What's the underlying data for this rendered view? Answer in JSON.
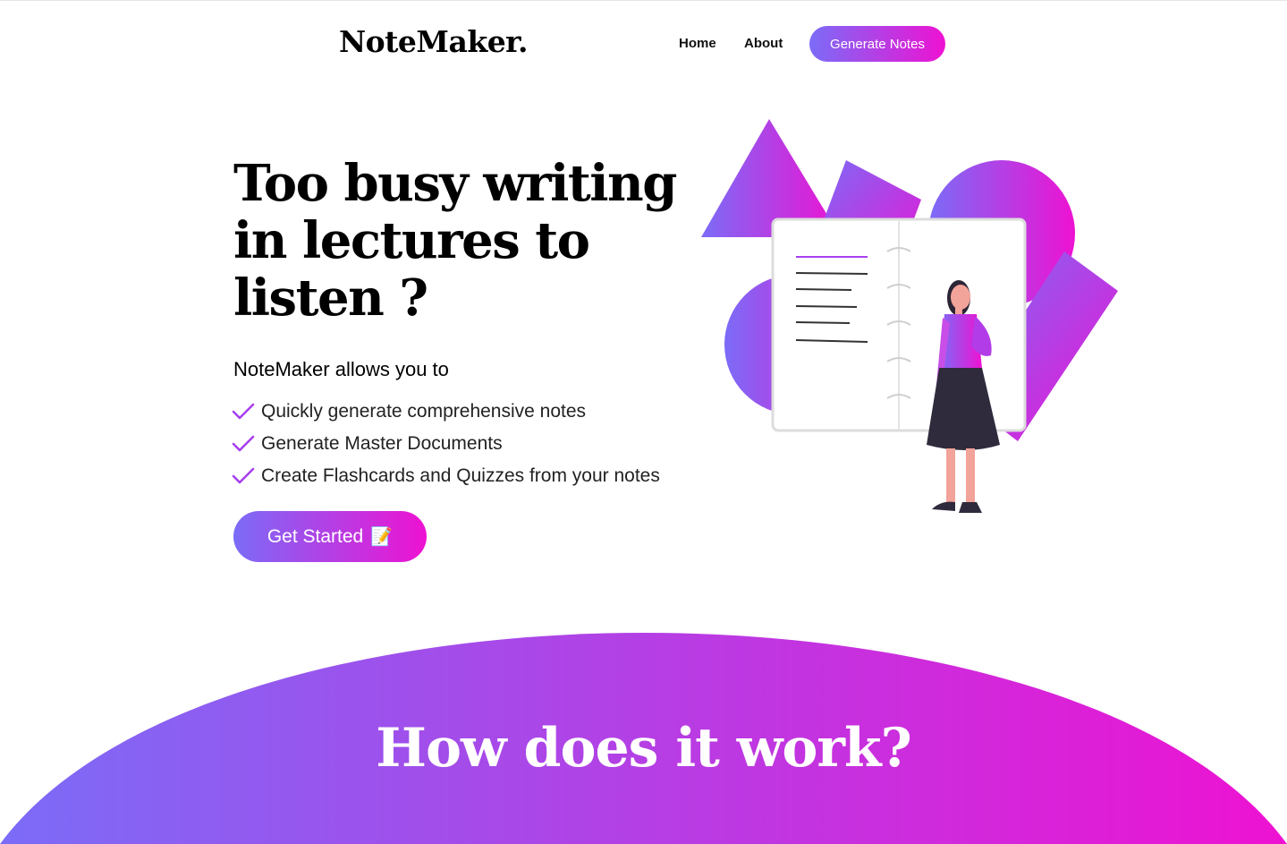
{
  "nav": {
    "logo": "NoteMaker.",
    "links": [
      {
        "label": "Home"
      },
      {
        "label": "About"
      }
    ],
    "cta_label": "Generate Notes"
  },
  "hero": {
    "title": "Too busy writing in lectures to listen ?",
    "subtitle": "NoteMaker allows you to",
    "features": [
      "Quickly generate comprehensive notes",
      "Generate Master Documents",
      "Create Flashcards and Quizzes from your notes"
    ],
    "cta_label": "Get Started",
    "cta_emoji": "📝"
  },
  "section": {
    "title": "How does it work?"
  },
  "colors": {
    "gradient_start": "#7b6cf7",
    "gradient_end": "#ee12d2",
    "accent_purple": "#a63ff0"
  },
  "icons": {
    "feature_bullet": "checkmark-icon",
    "illustration": "woman-with-notebook-illustration"
  }
}
